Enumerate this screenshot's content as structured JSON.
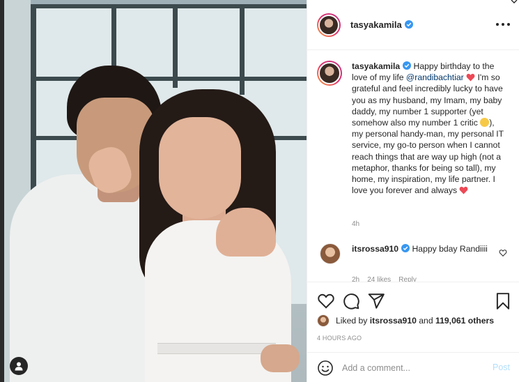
{
  "post": {
    "author": "tasyakamila",
    "more_icon": "more-horizontal-icon",
    "user_tag_icon": "person-icon"
  },
  "caption": {
    "author": "tasyakamila",
    "part1": " Happy birthday to the love of my life ",
    "mention": "@randibachtiar",
    "part2": " I'm so grateful and feel incredibly lucky to have you as my husband, my Imam, my baby daddy, my number 1 supporter (yet somehow also my number 1 critic ",
    "part3": "), my personal handy-man, my personal IT service, my go-to person when I cannot reach things that are way up high (not a metaphor, thanks for being so tall), my home, my inspiration, my life partner. I love you forever and always ",
    "time": "4h"
  },
  "comments": [
    {
      "author": "itsrossa910",
      "text": "Happy bday Randiiii",
      "time": "2h",
      "likes": "24 likes",
      "reply": "Reply"
    }
  ],
  "actions": {
    "like_icon": "heart-icon",
    "comment_icon": "comment-icon",
    "share_icon": "share-icon",
    "save_icon": "bookmark-icon"
  },
  "likes": {
    "prefix": "Liked by ",
    "user": "itsrossa910",
    "middle": " and ",
    "count": "119,061 others"
  },
  "timestamp": "4 HOURS AGO",
  "add_comment": {
    "placeholder": "Add a comment...",
    "post_label": "Post",
    "emoji_icon": "smile-icon"
  },
  "colors": {
    "text": "#262626",
    "muted": "#8e8e8e",
    "link": "#00376b",
    "verified": "#3897f0",
    "heart": "#ed4956",
    "post_disabled": "#b2dffc"
  }
}
